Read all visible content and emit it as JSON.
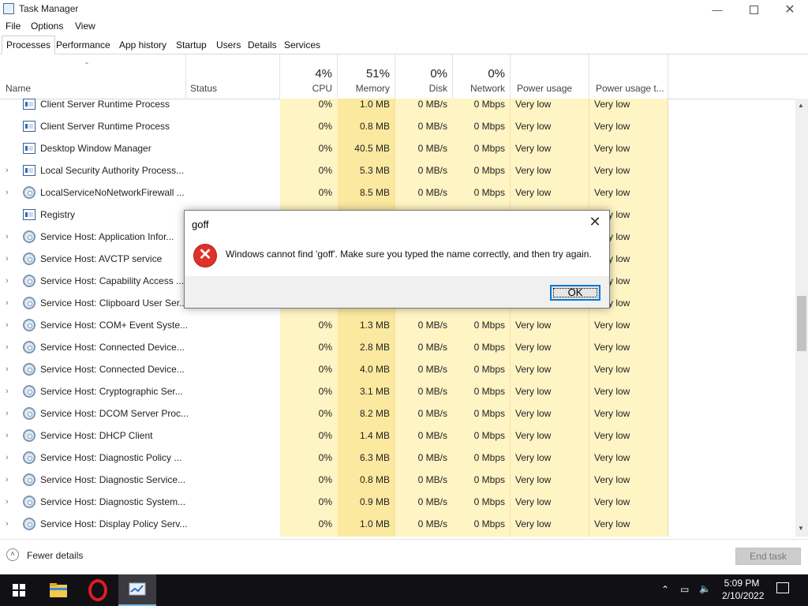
{
  "window": {
    "title": "Task Manager"
  },
  "menu": [
    "File",
    "Options",
    "View"
  ],
  "tabs": [
    "Processes",
    "Performance",
    "App history",
    "Startup",
    "Users",
    "Details",
    "Services"
  ],
  "columns": {
    "name": "Name",
    "status": "Status",
    "cpu_pct": "4%",
    "cpu": "CPU",
    "memory_pct": "51%",
    "memory": "Memory",
    "disk_pct": "0%",
    "disk": "Disk",
    "network_pct": "0%",
    "network": "Network",
    "power": "Power usage",
    "power_trend": "Power usage t..."
  },
  "rows": [
    {
      "name": "Client Server Runtime Process",
      "icon": "window",
      "expand": false,
      "cpu": "0%",
      "memory": "1.0 MB",
      "disk": "0 MB/s",
      "network": "0 Mbps",
      "power": "Very low",
      "power_trend": "Very low"
    },
    {
      "name": "Client Server Runtime Process",
      "icon": "window",
      "expand": false,
      "cpu": "0%",
      "memory": "0.8 MB",
      "disk": "0 MB/s",
      "network": "0 Mbps",
      "power": "Very low",
      "power_trend": "Very low"
    },
    {
      "name": "Desktop Window Manager",
      "icon": "window",
      "expand": false,
      "cpu": "0%",
      "memory": "40.5 MB",
      "disk": "0 MB/s",
      "network": "0 Mbps",
      "power": "Very low",
      "power_trend": "Very low"
    },
    {
      "name": "Local Security Authority Process...",
      "icon": "window",
      "expand": true,
      "cpu": "0%",
      "memory": "5.3 MB",
      "disk": "0 MB/s",
      "network": "0 Mbps",
      "power": "Very low",
      "power_trend": "Very low"
    },
    {
      "name": "LocalServiceNoNetworkFirewall ...",
      "icon": "gear",
      "expand": true,
      "cpu": "0%",
      "memory": "8.5 MB",
      "disk": "0 MB/s",
      "network": "0 Mbps",
      "power": "Very low",
      "power_trend": "Very low"
    },
    {
      "name": "Registry",
      "icon": "window",
      "expand": false,
      "cpu": "",
      "memory": "",
      "disk": "",
      "network": "",
      "power": "",
      "power_trend": "Very low"
    },
    {
      "name": "Service Host: Application Infor...",
      "icon": "gear",
      "expand": true,
      "cpu": "",
      "memory": "",
      "disk": "",
      "network": "",
      "power": "",
      "power_trend": "Very low"
    },
    {
      "name": "Service Host: AVCTP service",
      "icon": "gear",
      "expand": true,
      "cpu": "",
      "memory": "",
      "disk": "",
      "network": "",
      "power": "",
      "power_trend": "Very low"
    },
    {
      "name": "Service Host: Capability Access ...",
      "icon": "gear",
      "expand": true,
      "cpu": "",
      "memory": "",
      "disk": "",
      "network": "",
      "power": "",
      "power_trend": "Very low"
    },
    {
      "name": "Service Host: Clipboard User Ser...",
      "icon": "gear",
      "expand": true,
      "cpu": "",
      "memory": "",
      "disk": "",
      "network": "",
      "power": "",
      "power_trend": "Very low"
    },
    {
      "name": "Service Host: COM+ Event Syste...",
      "icon": "gear",
      "expand": true,
      "cpu": "0%",
      "memory": "1.3 MB",
      "disk": "0 MB/s",
      "network": "0 Mbps",
      "power": "Very low",
      "power_trend": "Very low"
    },
    {
      "name": "Service Host: Connected Device...",
      "icon": "gear",
      "expand": true,
      "cpu": "0%",
      "memory": "2.8 MB",
      "disk": "0 MB/s",
      "network": "0 Mbps",
      "power": "Very low",
      "power_trend": "Very low"
    },
    {
      "name": "Service Host: Connected Device...",
      "icon": "gear",
      "expand": true,
      "cpu": "0%",
      "memory": "4.0 MB",
      "disk": "0 MB/s",
      "network": "0 Mbps",
      "power": "Very low",
      "power_trend": "Very low"
    },
    {
      "name": "Service Host: Cryptographic Ser...",
      "icon": "gear",
      "expand": true,
      "cpu": "0%",
      "memory": "3.1 MB",
      "disk": "0 MB/s",
      "network": "0 Mbps",
      "power": "Very low",
      "power_trend": "Very low"
    },
    {
      "name": "Service Host: DCOM Server Proc...",
      "icon": "gear",
      "expand": true,
      "cpu": "0%",
      "memory": "8.2 MB",
      "disk": "0 MB/s",
      "network": "0 Mbps",
      "power": "Very low",
      "power_trend": "Very low"
    },
    {
      "name": "Service Host: DHCP Client",
      "icon": "gear",
      "expand": true,
      "cpu": "0%",
      "memory": "1.4 MB",
      "disk": "0 MB/s",
      "network": "0 Mbps",
      "power": "Very low",
      "power_trend": "Very low"
    },
    {
      "name": "Service Host: Diagnostic Policy ...",
      "icon": "gear",
      "expand": true,
      "cpu": "0%",
      "memory": "6.3 MB",
      "disk": "0 MB/s",
      "network": "0 Mbps",
      "power": "Very low",
      "power_trend": "Very low"
    },
    {
      "name": "Service Host: Diagnostic Service...",
      "icon": "gear",
      "expand": true,
      "cpu": "0%",
      "memory": "0.8 MB",
      "disk": "0 MB/s",
      "network": "0 Mbps",
      "power": "Very low",
      "power_trend": "Very low"
    },
    {
      "name": "Service Host: Diagnostic System...",
      "icon": "gear",
      "expand": true,
      "cpu": "0%",
      "memory": "0.9 MB",
      "disk": "0 MB/s",
      "network": "0 Mbps",
      "power": "Very low",
      "power_trend": "Very low"
    },
    {
      "name": "Service Host: Display Policy Serv...",
      "icon": "gear",
      "expand": true,
      "cpu": "0%",
      "memory": "1.0 MB",
      "disk": "0 MB/s",
      "network": "0 Mbps",
      "power": "Very low",
      "power_trend": "Very low"
    }
  ],
  "footer": {
    "fewer_details": "Fewer details",
    "end_task": "End task"
  },
  "dialog": {
    "title": "goff",
    "message": "Windows cannot find 'goff'. Make sure you typed the name correctly, and then try again.",
    "ok": "OK",
    "icon": "error-icon"
  },
  "taskbar": {
    "time": "5:09 PM",
    "date": "2/10/2022"
  },
  "colors": {
    "highlight_column": "#fff4c4",
    "memory_column": "#fbe9a0",
    "accent": "#0078d7",
    "error": "#e0302a",
    "taskbar": "#101015"
  }
}
